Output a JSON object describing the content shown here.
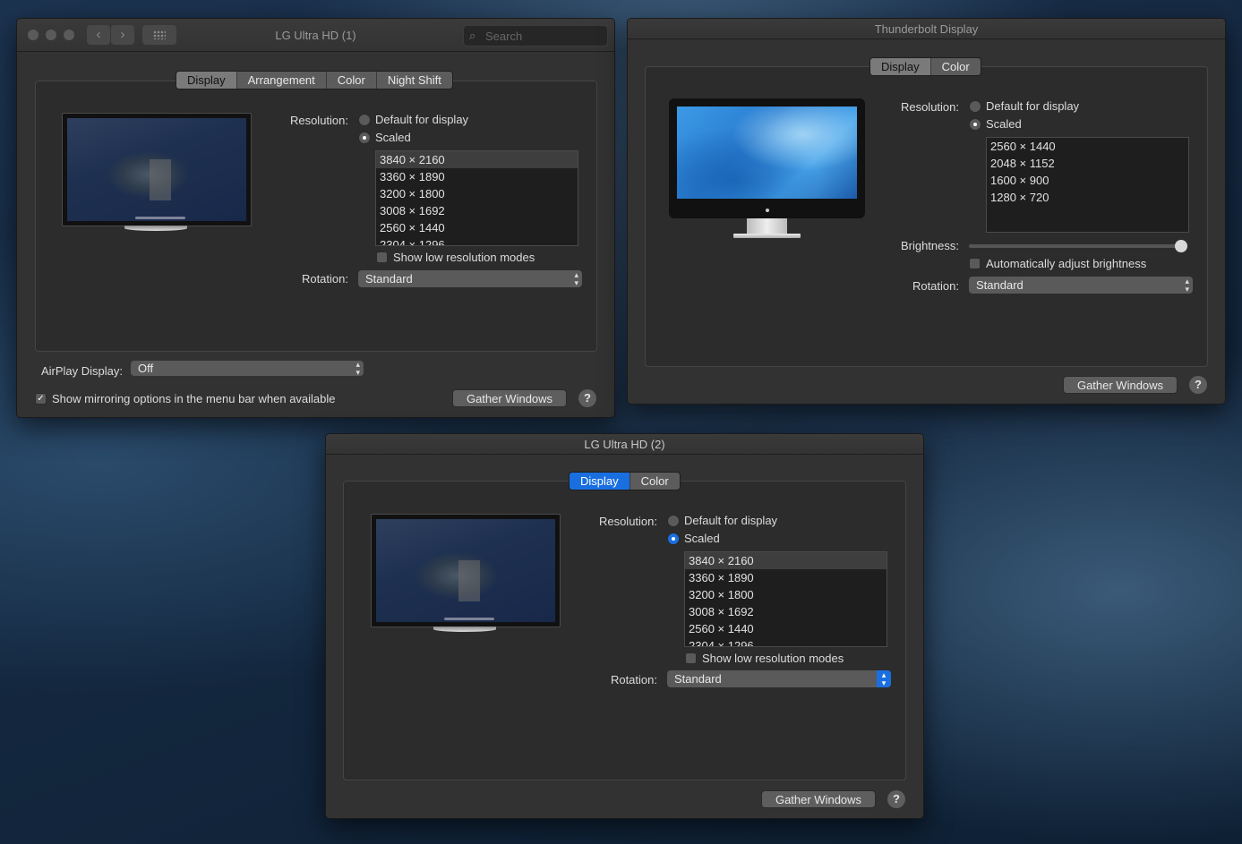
{
  "colors": {
    "accent": "#1a6fe0",
    "window_bg": "#323232",
    "panel_bg": "#2c2c2c"
  },
  "win1": {
    "title": "LG Ultra HD (1)",
    "search_placeholder": "Search",
    "tabs": [
      "Display",
      "Arrangement",
      "Color",
      "Night Shift"
    ],
    "selected_tab": "Display",
    "resolution_label": "Resolution:",
    "radio_default": "Default for display",
    "radio_scaled": "Scaled",
    "selected_radio": "Scaled",
    "resolutions": [
      "3840 × 2160",
      "3360 × 1890",
      "3200 × 1800",
      "3008 × 1692",
      "2560 × 1440",
      "2304 × 1296"
    ],
    "selected_resolution": "3840 × 2160",
    "low_res_label": "Show low resolution modes",
    "low_res_checked": false,
    "rotation_label": "Rotation:",
    "rotation_value": "Standard",
    "airplay_label": "AirPlay Display:",
    "airplay_value": "Off",
    "mirroring_label": "Show mirroring options in the menu bar when available",
    "mirroring_checked": true,
    "gather_label": "Gather Windows",
    "help_label": "?"
  },
  "win2": {
    "title": "Thunderbolt Display",
    "tabs": [
      "Display",
      "Color"
    ],
    "selected_tab": "Display",
    "resolution_label": "Resolution:",
    "radio_default": "Default for display",
    "radio_scaled": "Scaled",
    "selected_radio": "Scaled",
    "resolutions": [
      "2560 × 1440",
      "2048 × 1152",
      "1600 × 900",
      "1280 × 720"
    ],
    "brightness_label": "Brightness:",
    "brightness_level": 1.0,
    "auto_brightness_label": "Automatically adjust brightness",
    "auto_brightness_checked": false,
    "rotation_label": "Rotation:",
    "rotation_value": "Standard",
    "gather_label": "Gather Windows",
    "help_label": "?"
  },
  "win3": {
    "title": "LG Ultra HD (2)",
    "tabs": [
      "Display",
      "Color"
    ],
    "selected_tab": "Display",
    "resolution_label": "Resolution:",
    "radio_default": "Default for display",
    "radio_scaled": "Scaled",
    "selected_radio": "Scaled",
    "resolutions": [
      "3840 × 2160",
      "3360 × 1890",
      "3200 × 1800",
      "3008 × 1692",
      "2560 × 1440",
      "2304 × 1296"
    ],
    "selected_resolution": "3840 × 2160",
    "low_res_label": "Show low resolution modes",
    "low_res_checked": false,
    "rotation_label": "Rotation:",
    "rotation_value": "Standard",
    "gather_label": "Gather Windows",
    "help_label": "?"
  }
}
